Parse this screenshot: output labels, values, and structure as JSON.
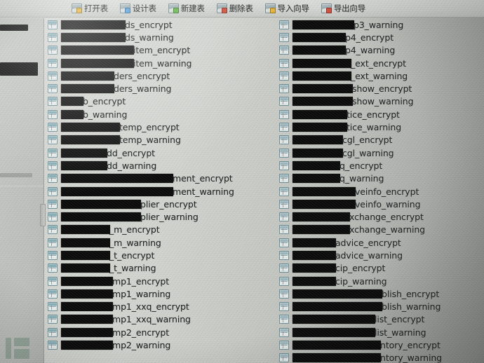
{
  "window": {
    "app_kind": "database-table-browser",
    "background_color": "#c9ccc8"
  },
  "toolbar": {
    "items": [
      {
        "label": "打开表",
        "icon": "open-table-icon",
        "badge_color": "#e8b33c"
      },
      {
        "label": "设计表",
        "icon": "design-table-icon",
        "badge_color": "#5ba2d8"
      },
      {
        "label": "新建表",
        "icon": "new-table-icon",
        "badge_color": "#63b84a"
      },
      {
        "label": "删除表",
        "icon": "delete-table-icon",
        "badge_color": "#d1503f"
      },
      {
        "label": "导入向导",
        "icon": "import-wizard-icon",
        "badge_color": "#e8b33c"
      },
      {
        "label": "导出向导",
        "icon": "export-wizard-icon",
        "badge_color": "#d1503f"
      }
    ]
  },
  "navigator": {
    "redacted_entries": 2,
    "splitter": "pane-splitter"
  },
  "table_list": {
    "icon": "table-icon",
    "left_column": [
      {
        "redact_width": 92,
        "suffix": "ds_encrypt"
      },
      {
        "redact_width": 92,
        "suffix": "ds_warning"
      },
      {
        "redact_width": 104,
        "suffix": "item_encrypt"
      },
      {
        "redact_width": 104,
        "suffix": "item_warning"
      },
      {
        "redact_width": 76,
        "suffix": "ders_encrypt"
      },
      {
        "redact_width": 76,
        "suffix": "ders_warning"
      },
      {
        "redact_width": 32,
        "suffix": "b_encrypt"
      },
      {
        "redact_width": 32,
        "suffix": "b_warning"
      },
      {
        "redact_width": 84,
        "suffix": "temp_encrypt"
      },
      {
        "redact_width": 84,
        "suffix": "temp_warning"
      },
      {
        "redact_width": 66,
        "suffix": "dd_encrypt"
      },
      {
        "redact_width": 66,
        "suffix": "dd_warning"
      },
      {
        "redact_width": 160,
        "suffix": "ment_encrypt"
      },
      {
        "redact_width": 160,
        "suffix": "ment_warning"
      },
      {
        "redact_width": 114,
        "suffix": "plier_encrypt"
      },
      {
        "redact_width": 114,
        "suffix": "plier_warning"
      },
      {
        "redact_width": 70,
        "suffix": "_m_encrypt"
      },
      {
        "redact_width": 70,
        "suffix": "_m_warning"
      },
      {
        "redact_width": 70,
        "suffix": "_t_encrypt"
      },
      {
        "redact_width": 70,
        "suffix": "_t_warning"
      },
      {
        "redact_width": 74,
        "suffix": "mp1_encrypt"
      },
      {
        "redact_width": 74,
        "suffix": "mp1_warning"
      },
      {
        "redact_width": 74,
        "suffix": "mp1_xxq_encrypt"
      },
      {
        "redact_width": 74,
        "suffix": "mp1_xxq_warning"
      },
      {
        "redact_width": 74,
        "suffix": "mp2_encrypt"
      },
      {
        "redact_width": 74,
        "suffix": "mp2_warning"
      }
    ],
    "right_column": [
      {
        "redact_width": 88,
        "suffix": "p3_warning"
      },
      {
        "redact_width": 76,
        "suffix": "p4_encrypt"
      },
      {
        "redact_width": 76,
        "suffix": "p4_warning"
      },
      {
        "redact_width": 84,
        "suffix": "_ext_encrypt"
      },
      {
        "redact_width": 84,
        "suffix": "_ext_warning"
      },
      {
        "redact_width": 86,
        "suffix": "show_encrypt"
      },
      {
        "redact_width": 86,
        "suffix": "show_warning"
      },
      {
        "redact_width": 78,
        "suffix": "tice_encrypt"
      },
      {
        "redact_width": 78,
        "suffix": "tice_warning"
      },
      {
        "redact_width": 72,
        "suffix": "cgl_encrypt"
      },
      {
        "redact_width": 72,
        "suffix": "cgl_warning"
      },
      {
        "redact_width": 68,
        "suffix": "q_encrypt"
      },
      {
        "redact_width": 68,
        "suffix": "q_warning"
      },
      {
        "redact_width": 90,
        "suffix": "veinfo_encrypt"
      },
      {
        "redact_width": 90,
        "suffix": "veinfo_warning"
      },
      {
        "redact_width": 82,
        "suffix": "xchange_encrypt"
      },
      {
        "redact_width": 82,
        "suffix": "xchange_warning"
      },
      {
        "redact_width": 62,
        "suffix": "advice_encrypt"
      },
      {
        "redact_width": 62,
        "suffix": "advice_warning"
      },
      {
        "redact_width": 62,
        "suffix": "cip_encrypt"
      },
      {
        "redact_width": 62,
        "suffix": "cip_warning"
      },
      {
        "redact_width": 128,
        "suffix": "blish_encrypt"
      },
      {
        "redact_width": 128,
        "suffix": "blish_warning"
      },
      {
        "redact_width": 118,
        "suffix": "list_encrypt"
      },
      {
        "redact_width": 118,
        "suffix": "list_warning"
      },
      {
        "redact_width": 126,
        "suffix": "ntory_encrypt"
      },
      {
        "redact_width": 126,
        "suffix": "ntory_warning"
      }
    ]
  }
}
